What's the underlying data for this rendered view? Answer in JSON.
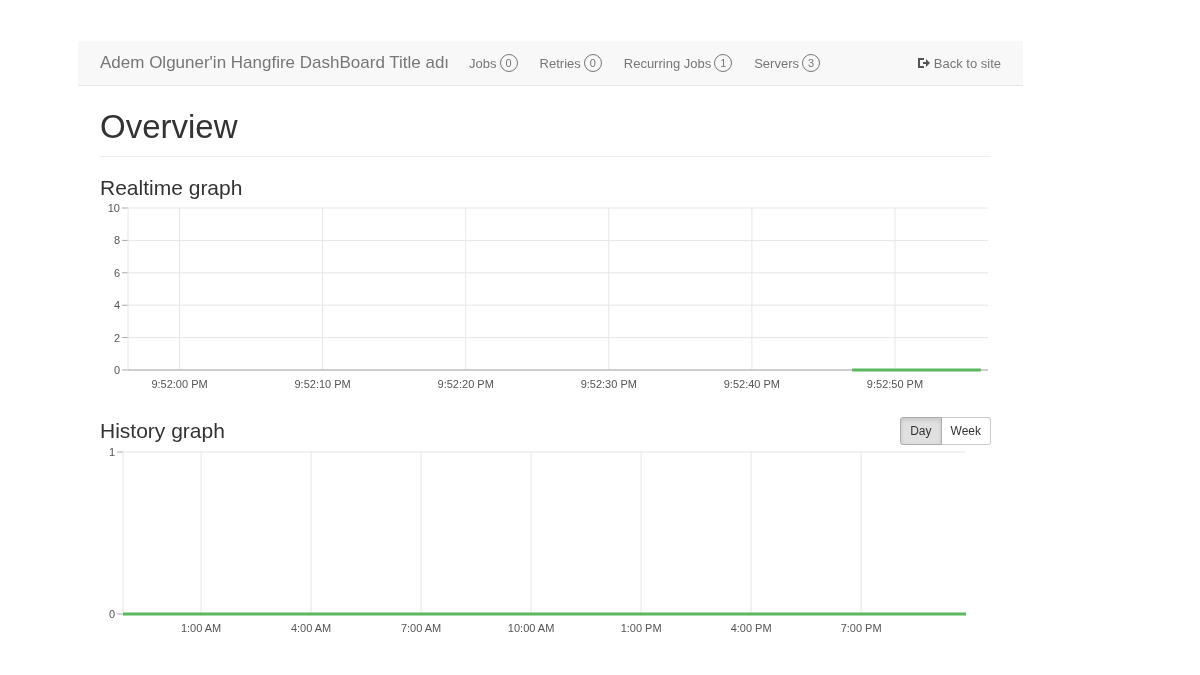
{
  "navbar": {
    "brand": "Adem Olguner'in Hangfire DashBoard Title adı",
    "items": [
      {
        "label": "Jobs",
        "count": "0"
      },
      {
        "label": "Retries",
        "count": "0"
      },
      {
        "label": "Recurring Jobs",
        "count": "1"
      },
      {
        "label": "Servers",
        "count": "3"
      }
    ],
    "back_link": "Back to site"
  },
  "page_title": "Overview",
  "realtime_graph": {
    "title": "Realtime graph",
    "chart_data": {
      "type": "line",
      "categories": [
        null,
        null,
        null,
        "9:52:00 PM",
        null,
        null,
        null,
        null,
        null,
        null,
        null,
        null,
        null,
        "9:52:10 PM",
        null,
        null,
        null,
        null,
        null,
        null,
        null,
        null,
        null,
        "9:52:20 PM",
        null,
        null,
        null,
        null,
        null,
        null,
        null,
        null,
        null,
        "9:52:30 PM",
        null,
        null,
        null,
        null,
        null,
        null,
        null,
        null,
        null,
        "9:52:40 PM",
        null,
        null,
        null,
        null,
        null,
        null,
        null,
        null,
        null,
        "9:52:50 PM",
        null,
        null,
        null,
        null,
        null,
        null
      ],
      "series": [
        {
          "color": "#5cb85c",
          "values": [
            null,
            null,
            null,
            null,
            null,
            null,
            null,
            null,
            null,
            null,
            null,
            null,
            null,
            null,
            null,
            null,
            null,
            null,
            null,
            null,
            null,
            null,
            null,
            null,
            null,
            null,
            null,
            null,
            null,
            null,
            null,
            null,
            null,
            null,
            null,
            null,
            null,
            null,
            null,
            null,
            null,
            null,
            null,
            null,
            null,
            null,
            null,
            null,
            null,
            null,
            0,
            0,
            0,
            0,
            0,
            0,
            0,
            0,
            0,
            0
          ]
        }
      ],
      "ylim": [
        0,
        10
      ],
      "grid": true,
      "yticks": [
        0,
        2,
        4,
        6,
        8,
        10
      ]
    }
  },
  "history_graph": {
    "title": "History graph",
    "ranges": [
      {
        "label": "Day",
        "selected": true
      },
      {
        "label": "Week",
        "selected": false
      }
    ],
    "chart_data": {
      "type": "line",
      "x": [
        -1.13,
        21.86
      ],
      "series": [
        {
          "color": "#5cb85c",
          "values": [
            0,
            0
          ]
        }
      ],
      "xlim": [
        -1.13,
        21.86
      ],
      "ylim": [
        0,
        1
      ],
      "grid": true,
      "xticks": [
        {
          "value": 1,
          "label": "1:00 AM"
        },
        {
          "value": 4,
          "label": "4:00 AM"
        },
        {
          "value": 7,
          "label": "7:00 AM"
        },
        {
          "value": 10,
          "label": "10:00 AM"
        },
        {
          "value": 13,
          "label": "1:00 PM"
        },
        {
          "value": 16,
          "label": "4:00 PM"
        },
        {
          "value": 19,
          "label": "7:00 PM"
        }
      ],
      "yticks": [
        0,
        1
      ]
    }
  }
}
